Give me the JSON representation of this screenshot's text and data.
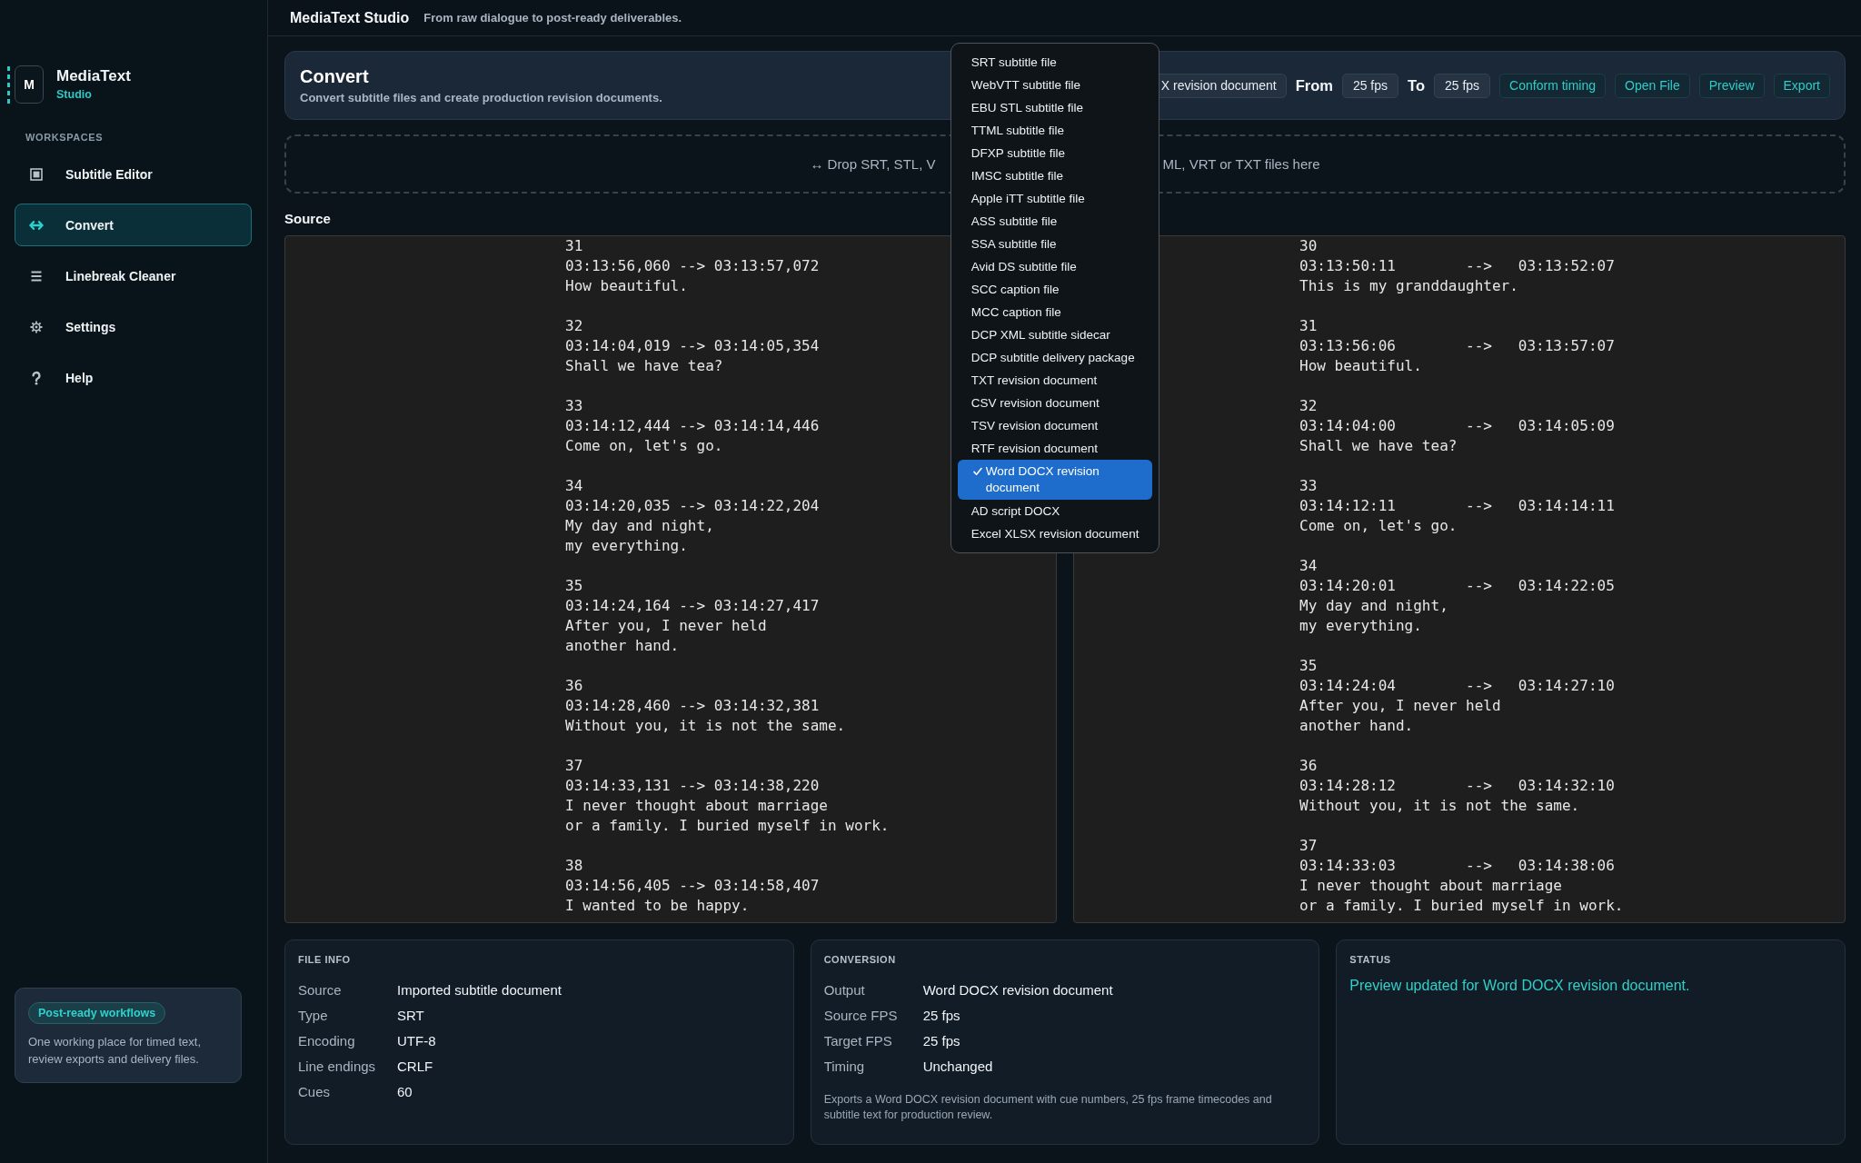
{
  "app_bar": {
    "title": "MediaText Studio",
    "tagline": "From raw dialogue to post-ready deliverables."
  },
  "sidebar": {
    "logo_mark": "M",
    "brand": "MediaText",
    "brand_subtitle": "Studio",
    "section_label": "WORKSPACES",
    "items": [
      {
        "label": "Subtitle Editor",
        "selected": false
      },
      {
        "label": "Convert",
        "selected": true
      },
      {
        "label": "Linebreak Cleaner",
        "selected": false
      },
      {
        "label": "Settings",
        "selected": false
      },
      {
        "label": "Help",
        "selected": false
      }
    ],
    "promo": {
      "badge": "Post-ready workflows",
      "text": "One working place for timed text, review exports and delivery files."
    }
  },
  "page_header": {
    "title": "Convert",
    "subtitle": "Convert subtitle files and create production revision documents.",
    "format_select": {
      "value": "X revision document",
      "expanded": true,
      "options": [
        {
          "label": "SRT subtitle file",
          "selected": false
        },
        {
          "label": "WebVTT subtitle file",
          "selected": false
        },
        {
          "label": "EBU STL subtitle file",
          "selected": false
        },
        {
          "label": "TTML subtitle file",
          "selected": false
        },
        {
          "label": "DFXP subtitle file",
          "selected": false
        },
        {
          "label": "IMSC subtitle file",
          "selected": false
        },
        {
          "label": "Apple iTT subtitle file",
          "selected": false
        },
        {
          "label": "ASS subtitle file",
          "selected": false
        },
        {
          "label": "SSA subtitle file",
          "selected": false
        },
        {
          "label": "Avid DS subtitle file",
          "selected": false
        },
        {
          "label": "SCC caption file",
          "selected": false
        },
        {
          "label": "MCC caption file",
          "selected": false
        },
        {
          "label": "DCP XML subtitle sidecar",
          "selected": false
        },
        {
          "label": "DCP subtitle delivery package",
          "selected": false
        },
        {
          "label": "TXT revision document",
          "selected": false
        },
        {
          "label": "CSV revision document",
          "selected": false
        },
        {
          "label": "TSV revision document",
          "selected": false
        },
        {
          "label": "RTF revision document",
          "selected": false
        },
        {
          "label": "Word DOCX revision document",
          "selected": true
        },
        {
          "label": "AD script DOCX",
          "selected": false
        },
        {
          "label": "Excel XLSX revision document",
          "selected": false
        }
      ]
    },
    "from_label": "From",
    "from_fps": "25 fps",
    "to_label": "To",
    "to_fps": "25 fps",
    "buttons": [
      "Conform timing",
      "Open File",
      "Preview",
      "Export"
    ]
  },
  "drop_zone": {
    "text_parts": [
      "↔ Drop SRT, STL, V",
      "ML, VRT or TXT files here"
    ]
  },
  "source": {
    "heading": "Source",
    "cues": [
      {
        "number": "31",
        "timing": "03:13:56,060 --> 03:13:57,072",
        "text": "How beautiful."
      },
      {
        "number": "32",
        "timing": "03:14:04,019 --> 03:14:05,354",
        "text": "Shall we have tea?"
      },
      {
        "number": "33",
        "timing": "03:14:12,444 --> 03:14:14,446",
        "text": "Come on, let's go."
      },
      {
        "number": "34",
        "timing": "03:14:20,035 --> 03:14:22,204",
        "text": "My day and night,\nmy everything."
      },
      {
        "number": "35",
        "timing": "03:14:24,164 --> 03:14:27,417",
        "text": "After you, I never held\nanother hand."
      },
      {
        "number": "36",
        "timing": "03:14:28,460 --> 03:14:32,381",
        "text": "Without you, it is not the same."
      },
      {
        "number": "37",
        "timing": "03:14:33,131 --> 03:14:38,220",
        "text": "I never thought about marriage\nor a family. I buried myself in work."
      },
      {
        "number": "38",
        "timing": "03:14:56,405 --> 03:14:58,407",
        "text": "I wanted to be happy."
      }
    ]
  },
  "preview": {
    "cues": [
      {
        "number": "30",
        "timing": "03:13:50:11        -->   03:13:52:07",
        "text": "This is my granddaughter."
      },
      {
        "number": "31",
        "timing": "03:13:56:06        -->   03:13:57:07",
        "text": "How beautiful."
      },
      {
        "number": "32",
        "timing": "03:14:04:00        -->   03:14:05:09",
        "text": "Shall we have tea?"
      },
      {
        "number": "33",
        "timing": "03:14:12:11        -->   03:14:14:11",
        "text": "Come on, let's go."
      },
      {
        "number": "34",
        "timing": "03:14:20:01        -->   03:14:22:05",
        "text": "My day and night,\nmy everything."
      },
      {
        "number": "35",
        "timing": "03:14:24:04        -->   03:14:27:10",
        "text": "After you, I never held\nanother hand."
      },
      {
        "number": "36",
        "timing": "03:14:28:12        -->   03:14:32:10",
        "text": "Without you, it is not the same."
      },
      {
        "number": "37",
        "timing": "03:14:33:03        -->   03:14:38:06",
        "text": "I never thought about marriage\nor a family. I buried myself in work."
      }
    ]
  },
  "file_info": {
    "heading": "FILE INFO",
    "rows": [
      {
        "label": "Source",
        "value": "Imported subtitle document"
      },
      {
        "label": "Type",
        "value": "SRT"
      },
      {
        "label": "Encoding",
        "value": "UTF-8"
      },
      {
        "label": "Line endings",
        "value": "CRLF"
      },
      {
        "label": "Cues",
        "value": "60"
      }
    ]
  },
  "conversion": {
    "heading": "CONVERSION",
    "rows": [
      {
        "label": "Output",
        "value": "Word DOCX revision document"
      },
      {
        "label": "Source FPS",
        "value": "25 fps"
      },
      {
        "label": "Target FPS",
        "value": "25 fps"
      },
      {
        "label": "Timing",
        "value": "Unchanged"
      }
    ],
    "note": "Exports a Word DOCX revision document with cue numbers, 25 fps frame timecodes and subtitle text for production review."
  },
  "status": {
    "heading": "STATUS",
    "message": "Preview updated for Word DOCX revision document."
  }
}
